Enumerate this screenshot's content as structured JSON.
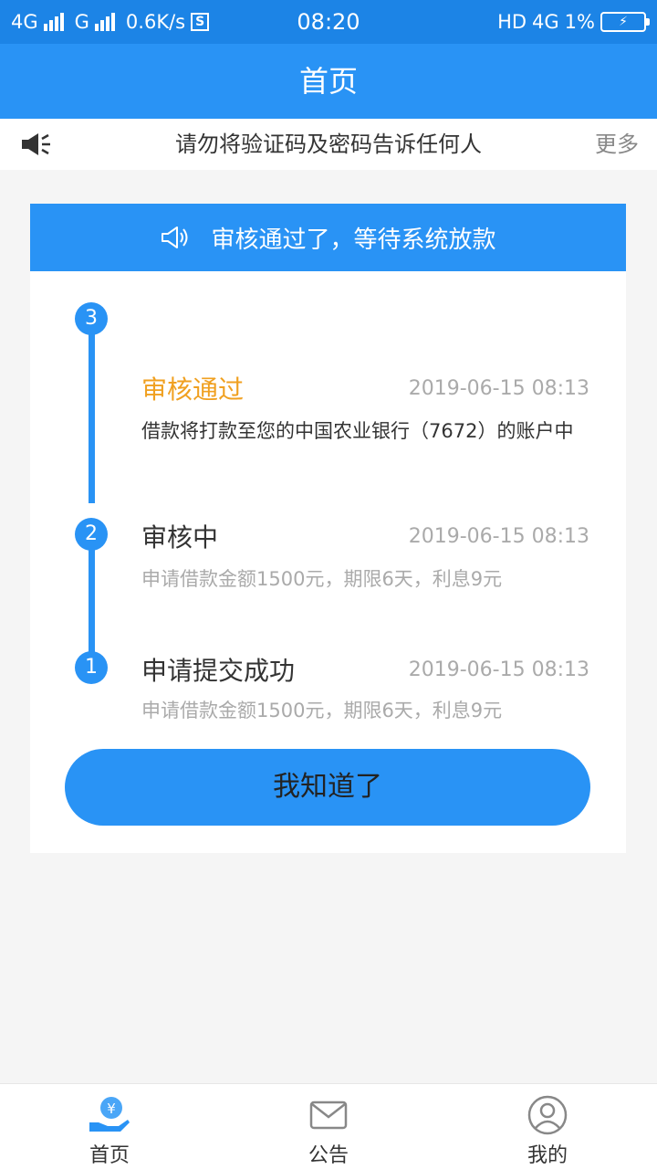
{
  "status_bar": {
    "net1": "4G",
    "net2": "G",
    "speed": "0.6K/s",
    "s_badge": "S",
    "time": "08:20",
    "hd": "HD",
    "net3": "4G",
    "battery_pct": "1%",
    "battery_symbol": "⚡"
  },
  "header": {
    "title": "首页"
  },
  "notice": {
    "icon": "speaker-icon",
    "text": "请勿将验证码及密码告诉任何人",
    "more": "更多"
  },
  "card": {
    "banner_icon": "megaphone-icon",
    "banner_text": "审核通过了，等待系统放款",
    "steps": [
      {
        "num": "3",
        "title": "审核通过",
        "time": "2019-06-15 08:13",
        "desc": "借款将打款至您的中国农业银行（7672）的账户中"
      },
      {
        "num": "2",
        "title": "审核中",
        "time": "2019-06-15 08:13",
        "desc": "申请借款金额1500元，期限6天，利息9元"
      },
      {
        "num": "1",
        "title": "申请提交成功",
        "time": "2019-06-15 08:13",
        "desc": "申请借款金额1500元，期限6天，利息9元"
      }
    ],
    "button_label": "我知道了"
  },
  "bottom_nav": {
    "items": [
      {
        "label": "首页",
        "icon": "coin-hand-icon",
        "active": true
      },
      {
        "label": "公告",
        "icon": "envelope-icon",
        "active": false
      },
      {
        "label": "我的",
        "icon": "user-icon",
        "active": false
      }
    ]
  },
  "colors": {
    "primary": "#2993f5",
    "status_bar": "#1c84e6",
    "highlight": "#f0a020",
    "muted_text": "#aaaaaa"
  }
}
